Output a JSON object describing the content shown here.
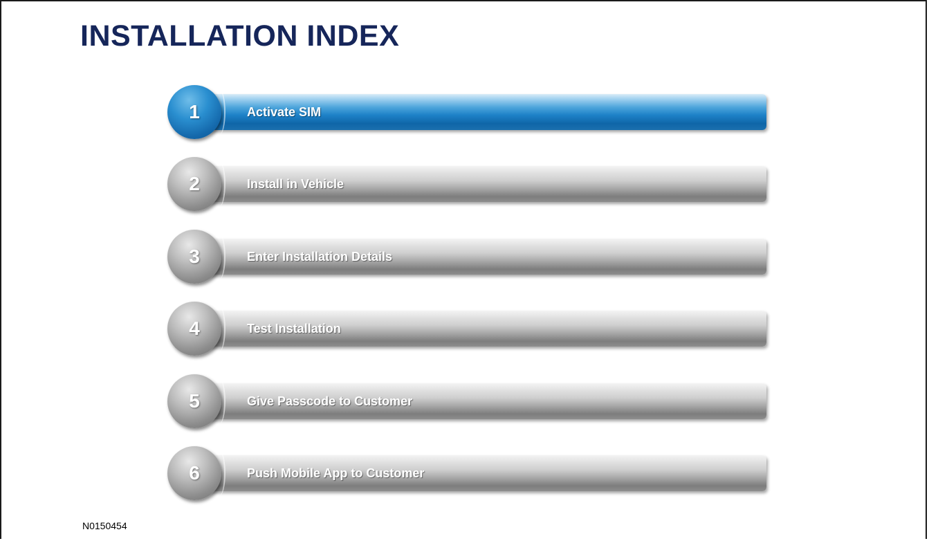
{
  "page": {
    "title": "INSTALLATION INDEX",
    "figure_id": "N0150454"
  },
  "colors": {
    "title": "#16265a",
    "active_step": "#1e82c8",
    "inactive_step": "#a9a9a9"
  },
  "steps": [
    {
      "number": "1",
      "label": "Activate SIM",
      "active": true
    },
    {
      "number": "2",
      "label": "Install in Vehicle",
      "active": false
    },
    {
      "number": "3",
      "label": "Enter Installation Details",
      "active": false
    },
    {
      "number": "4",
      "label": "Test Installation",
      "active": false
    },
    {
      "number": "5",
      "label": "Give Passcode to Customer",
      "active": false
    },
    {
      "number": "6",
      "label": "Push Mobile App to Customer",
      "active": false
    }
  ]
}
